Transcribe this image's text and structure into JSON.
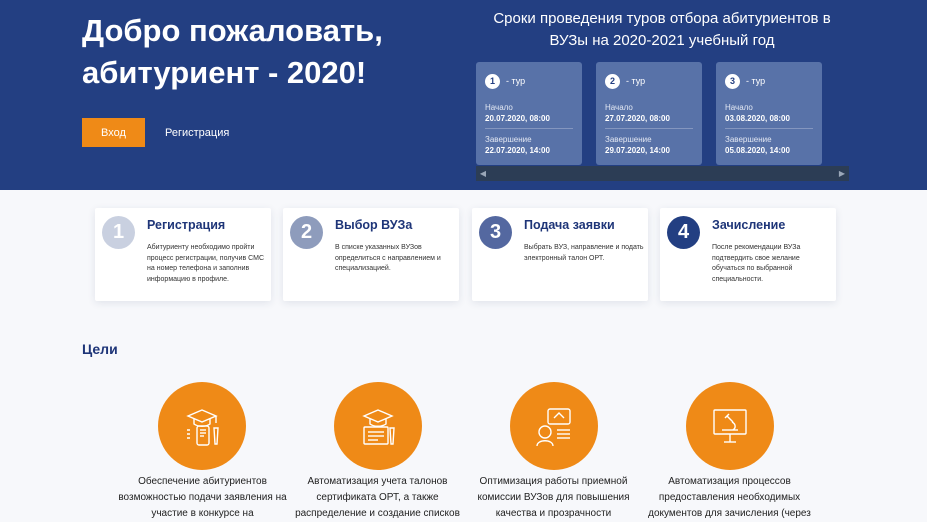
{
  "hero": {
    "title": "Добро пожаловать, абитуриент - 2020!",
    "login_label": "Вход",
    "register_label": "Регистрация"
  },
  "tours": {
    "title": "Сроки проведения туров отбора абитуриентов в ВУЗы на 2020-2021 учебный год",
    "start_label": "Начало",
    "end_label": "Завершение",
    "items": [
      {
        "num": "1",
        "label": "- тур",
        "start": "20.07.2020,  08:00",
        "end": "22.07.2020,  14:00"
      },
      {
        "num": "2",
        "label": "- тур",
        "start": "27.07.2020,  08:00",
        "end": "29.07.2020,  14:00"
      },
      {
        "num": "3",
        "label": "- тур",
        "start": "03.08.2020,  08:00",
        "end": "05.08.2020,  14:00"
      }
    ]
  },
  "steps": [
    {
      "num": "1",
      "title": "Регистрация",
      "desc": "Абитуриенту необходимо пройти процесс регистрации, получив СМС на номер телефона и заполнив информацию в профиле.",
      "color": "#c9d0e0"
    },
    {
      "num": "2",
      "title": "Выбор ВУЗа",
      "desc": "В списке указанных ВУЗов определиться с направлением и специализацией.",
      "color": "#8e9cbc"
    },
    {
      "num": "3",
      "title": "Подача заявки",
      "desc": "Выбрать ВУЗ, направление и подать электронный талон ОРТ.",
      "color": "#5468a0"
    },
    {
      "num": "4",
      "title": "Зачисление",
      "desc": "После рекомендации ВУЗа подтвердить свое желание обучаться по выбранной специальности.",
      "color": "#233f82"
    }
  ],
  "goals": {
    "title": "Цели",
    "items": [
      {
        "icon": "graduate-mobile-icon",
        "text": "Обеспечение абитуриентов возможностью подачи заявления на участие в конкурсе на"
      },
      {
        "icon": "graduate-certificate-icon",
        "text": "Автоматизация учета талонов сертификата ОРТ, а также распределение и создание списков"
      },
      {
        "icon": "commission-chat-icon",
        "text": "Оптимизация работы приемной комиссии ВУЗов для повышения качества и прозрачности"
      },
      {
        "icon": "microscope-monitor-icon",
        "text": "Автоматизация процессов предоставления необходимых документов для зачисления (через"
      }
    ]
  },
  "colors": {
    "hero_bg": "#233f82",
    "accent": "#ef8a17",
    "tour_card": "#5872a8"
  }
}
